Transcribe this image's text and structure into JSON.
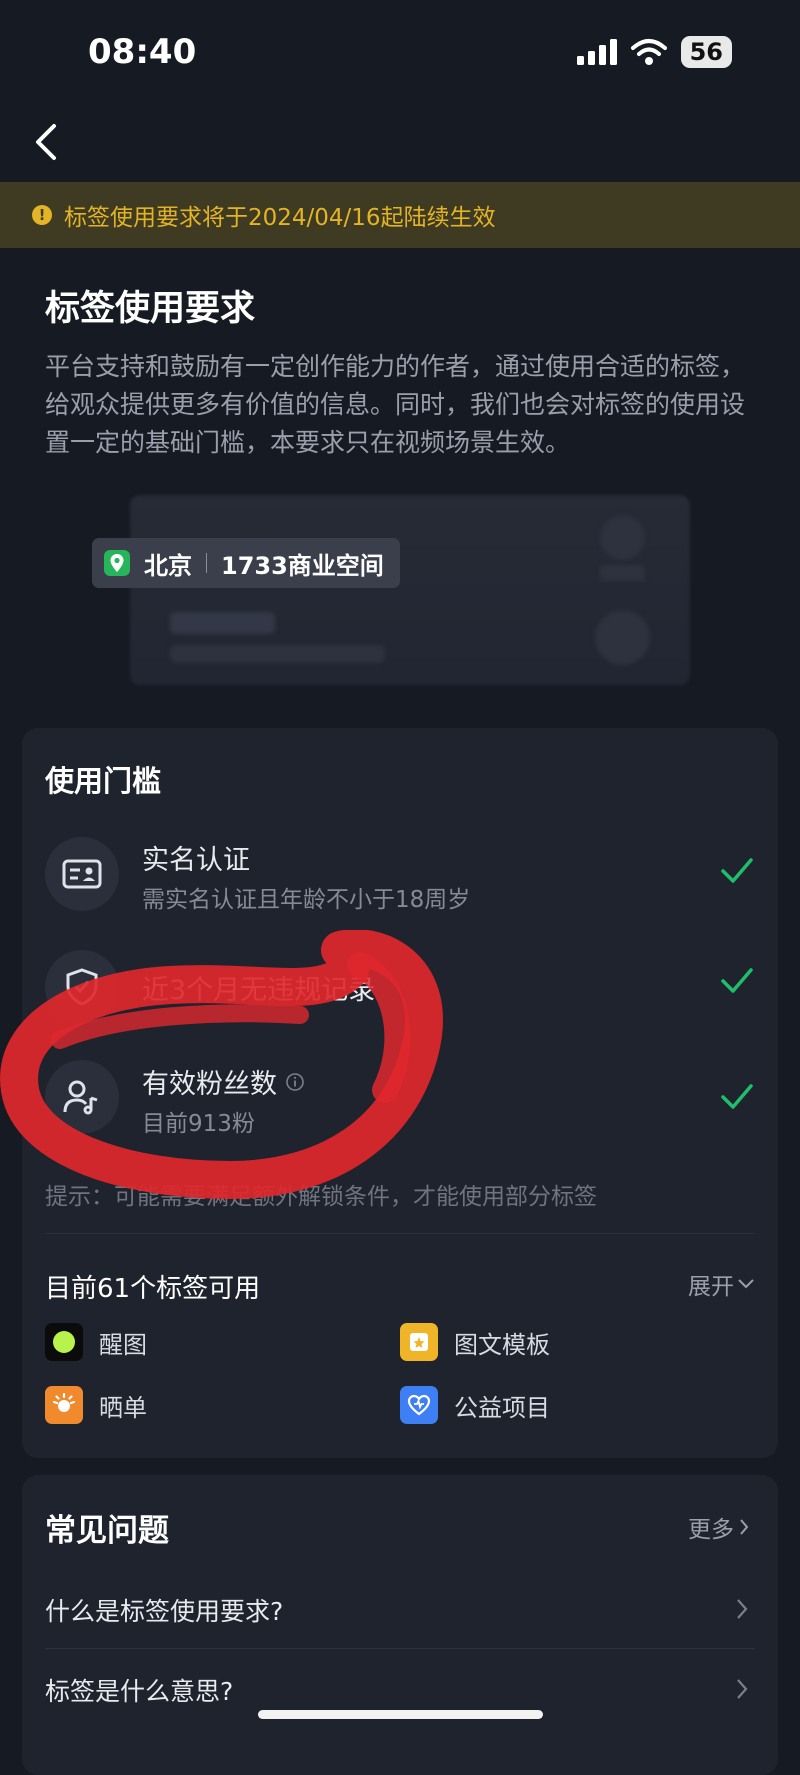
{
  "status_bar": {
    "time": "08:40",
    "battery": "56"
  },
  "notice": {
    "text": "标签使用要求将于2024/04/16起陆续生效"
  },
  "page": {
    "title": "标签使用要求",
    "description": "平台支持和鼓励有一定创作能力的作者，通过使用合适的标签，给观众提供更多有价值的信息。同时，我们也会对标签的使用设置一定的基础门槛，本要求只在视频场景生效。"
  },
  "preview": {
    "city": "北京",
    "place": "1733商业空间"
  },
  "threshold": {
    "title": "使用门槛",
    "items": [
      {
        "name": "实名认证",
        "sub": "需实名认证且年龄不小于18周岁",
        "icon": "id-card-icon",
        "met": true
      },
      {
        "name": "近3个月无违规记录",
        "sub": "",
        "icon": "shield-icon",
        "met": true
      },
      {
        "name": "有效粉丝数",
        "sub": "目前913粉",
        "icon": "fans-icon",
        "met": true
      }
    ],
    "hint": "提示：可能需要满足额外解锁条件，才能使用部分标签",
    "available_title": "目前61个标签可用",
    "expand_label": "展开",
    "tags": [
      {
        "label": "醒图",
        "icon": "xingtu-icon",
        "color": "#0b0b0b"
      },
      {
        "label": "图文模板",
        "icon": "template-icon",
        "color": "#f0b429"
      },
      {
        "label": "晒单",
        "icon": "sun-icon",
        "color": "#f08a2c"
      },
      {
        "label": "公益项目",
        "icon": "charity-icon",
        "color": "#3e7ff5"
      }
    ]
  },
  "faq": {
    "title": "常见问题",
    "more_label": "更多",
    "items": [
      {
        "q": "什么是标签使用要求?"
      },
      {
        "q": "标签是什么意思?"
      }
    ]
  },
  "colors": {
    "accent_check": "#1fbe6a",
    "notice": "#e3b425",
    "annotation": "#e0282e"
  }
}
